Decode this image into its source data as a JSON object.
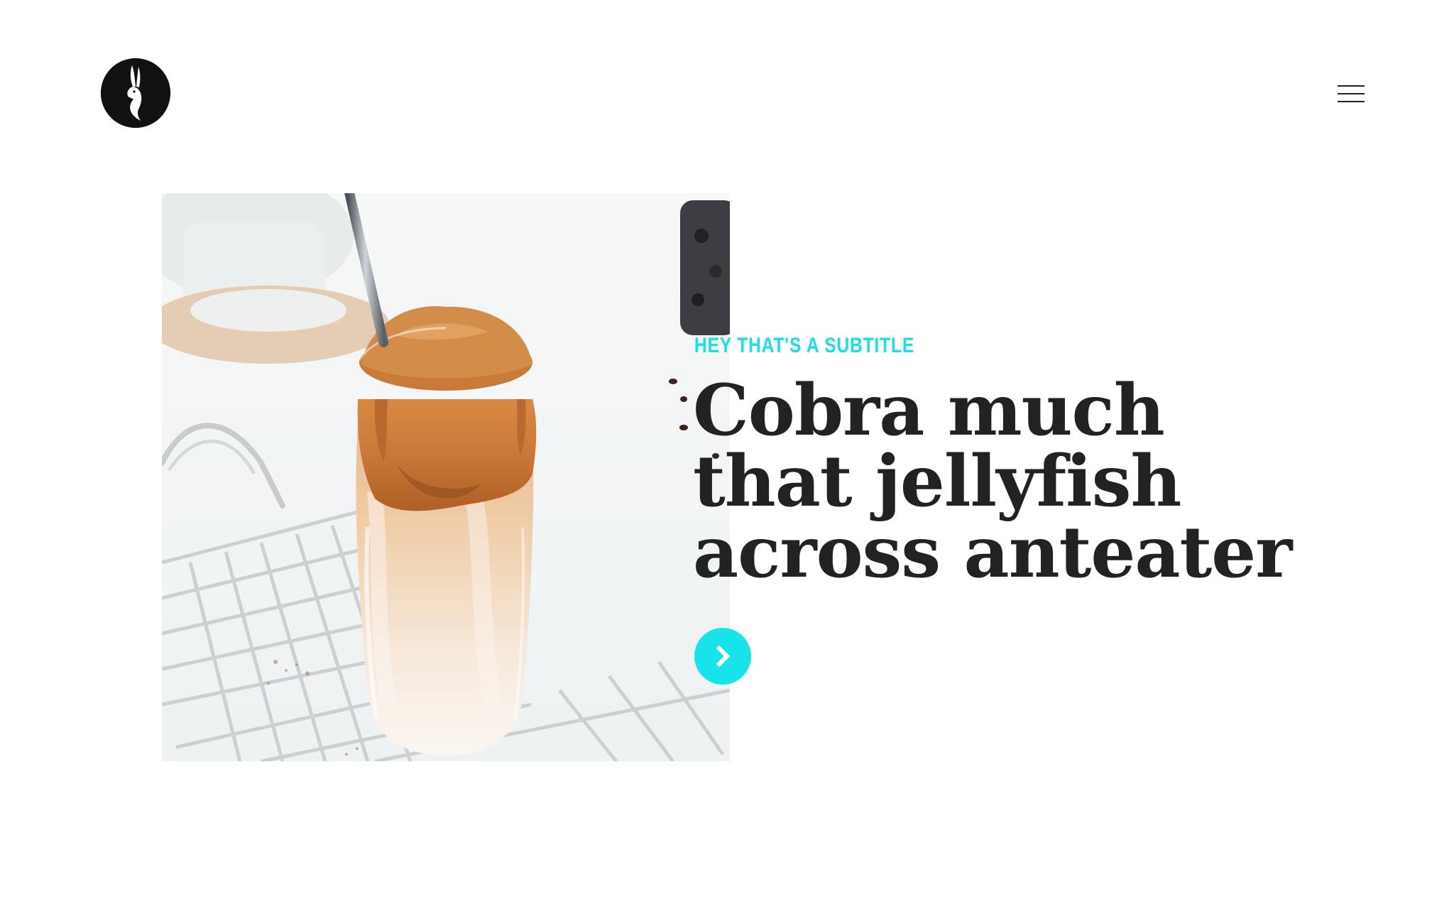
{
  "header": {
    "logo_icon": "rabbit-logo-icon",
    "menu_icon": "hamburger-menu-icon"
  },
  "hero": {
    "image_description_icon": "dalgona-coffee-photo",
    "subtitle": "HEY THAT'S A SUBTITLE",
    "title_lines": [
      "Cobra much",
      "that jellyfish",
      "across anteater"
    ],
    "cta_icon": "chevron-right-icon"
  },
  "colors": {
    "accent": "#19e3ea",
    "text": "#222222",
    "logo_bg": "#111111",
    "background": "#ffffff"
  }
}
